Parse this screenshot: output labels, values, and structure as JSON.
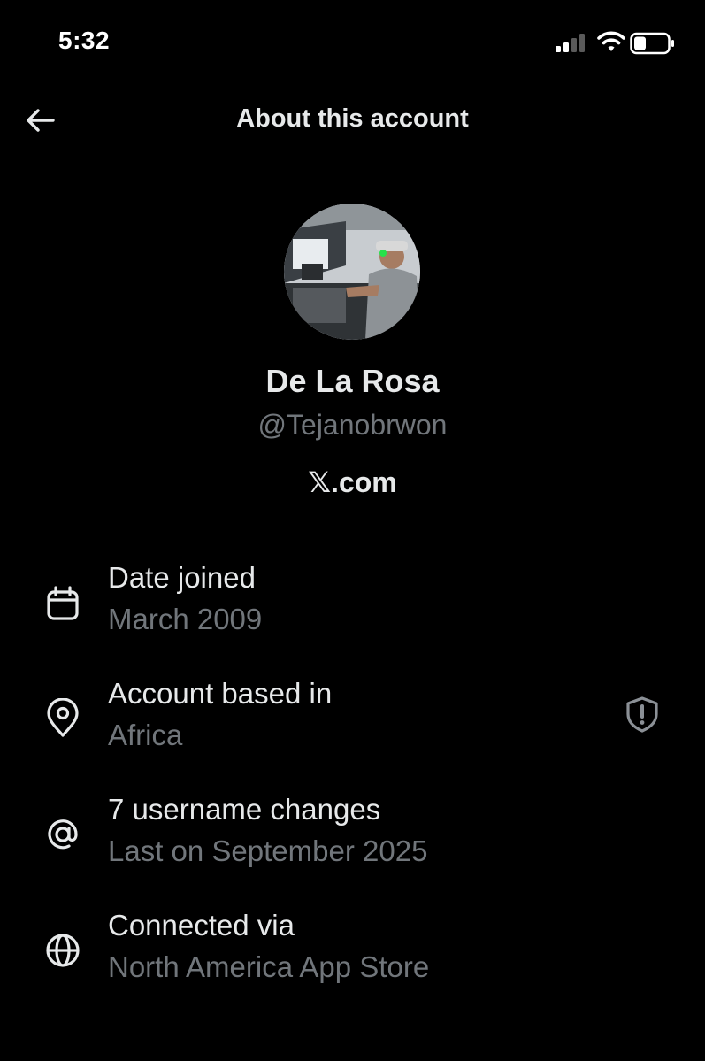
{
  "status": {
    "time": "5:32"
  },
  "header": {
    "title": "About this account"
  },
  "profile": {
    "name": "De La Rosa",
    "handle": "@Tejanobrwon",
    "site": "𝕏.com"
  },
  "info": [
    {
      "icon": "calendar-icon",
      "label": "Date joined",
      "value": "March 2009"
    },
    {
      "icon": "location-pin-icon",
      "label": "Account based in",
      "value": "Africa"
    },
    {
      "icon": "at-sign-icon",
      "label": "7 username changes",
      "value": "Last on September 2025"
    },
    {
      "icon": "globe-icon",
      "label": "Connected via",
      "value": "North America App Store"
    }
  ],
  "colors": {
    "background": "#000000",
    "primary_text": "#e7e9ea",
    "secondary_text": "#71767b"
  }
}
